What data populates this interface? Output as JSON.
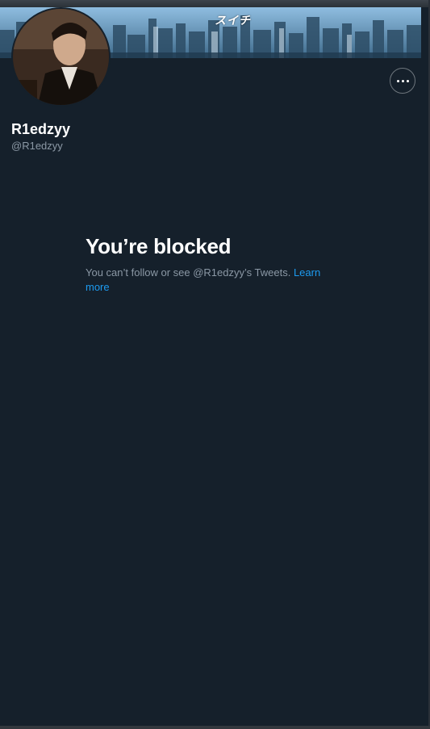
{
  "profile": {
    "display_name": "R1edzyy",
    "handle": "@R1edzyy",
    "banner_text": "スイチ"
  },
  "actions": {
    "more_icon": "more-horizontal-icon"
  },
  "blocked": {
    "title": "You’re blocked",
    "message": "You can’t follow or see @R1edzyy’s Tweets. ",
    "learn_more": "Learn more"
  },
  "colors": {
    "background": "#15202b",
    "primary_text": "#ffffff",
    "secondary_text": "#8b98a5",
    "link": "#1d9bf0"
  }
}
